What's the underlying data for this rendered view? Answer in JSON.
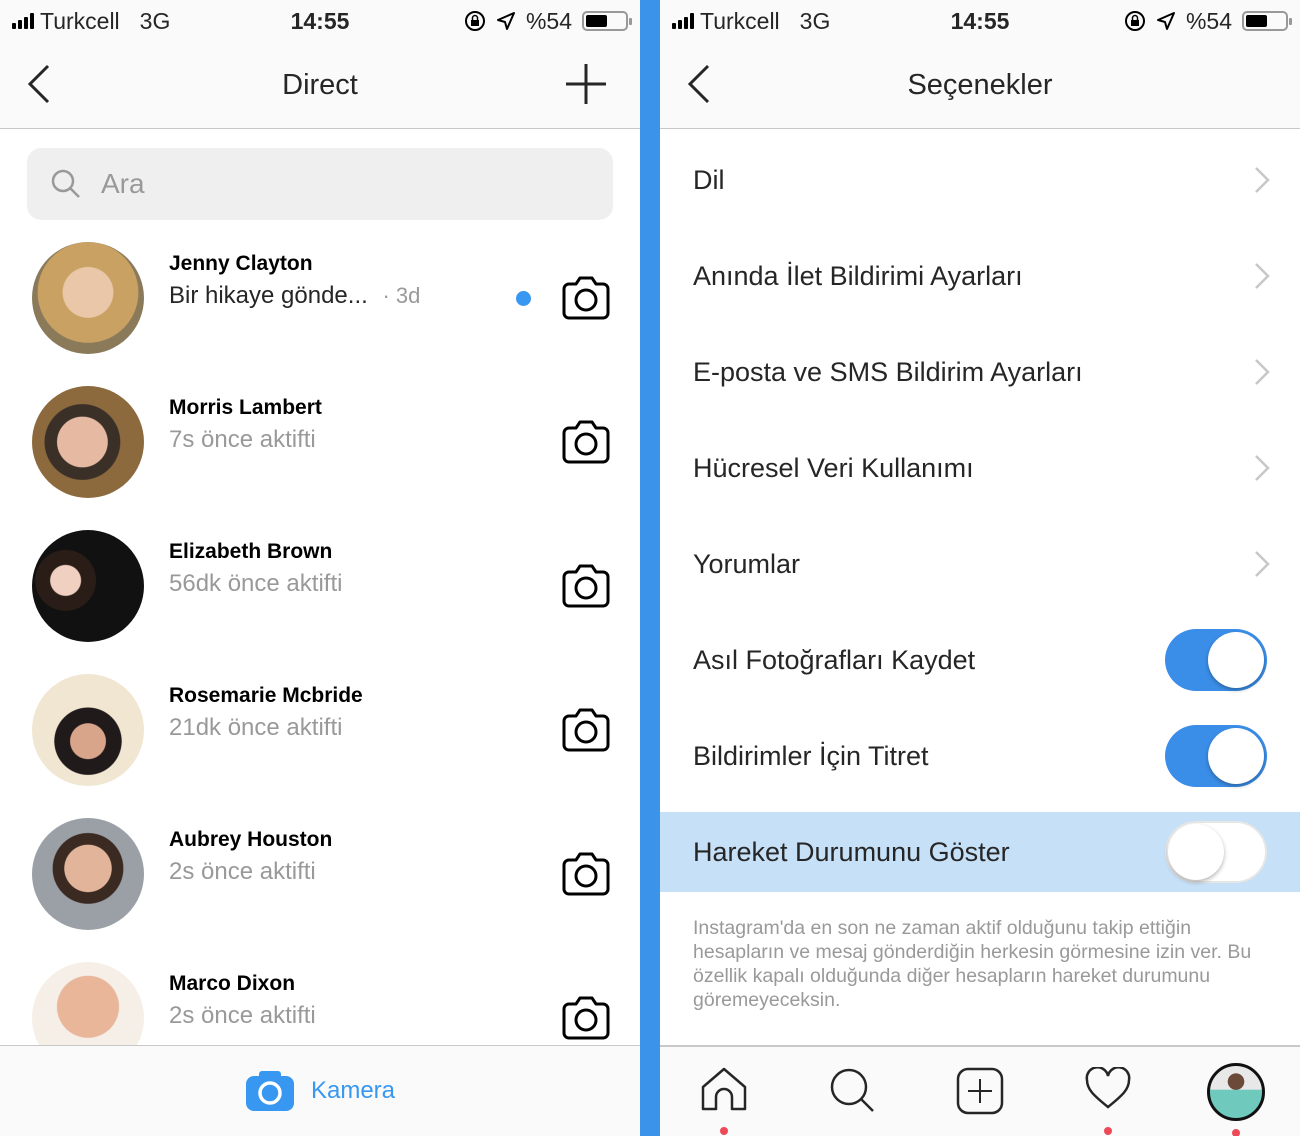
{
  "status_bar": {
    "carrier": "Turkcell",
    "network": "3G",
    "time": "14:55",
    "battery": "%54",
    "battery_level": 0.54
  },
  "colors": {
    "accent": "#3897f0",
    "divider": "#3b94ea",
    "highlight": "#c6e0f8",
    "notification_dot": "#ed4956"
  },
  "direct": {
    "title": "Direct",
    "search_placeholder": "Ara",
    "chats": [
      {
        "name": "Jenny Clayton",
        "subtitle": "Bir hikaye gönde...",
        "time": "· 3d",
        "unread": true
      },
      {
        "name": "Morris Lambert",
        "subtitle": "7s önce aktifti",
        "unread": false
      },
      {
        "name": "Elizabeth Brown",
        "subtitle": "56dk önce aktifti",
        "unread": false
      },
      {
        "name": "Rosemarie Mcbride",
        "subtitle": "21dk önce aktifti",
        "unread": false
      },
      {
        "name": "Aubrey Houston",
        "subtitle": "2s önce aktifti",
        "unread": false
      },
      {
        "name": "Marco Dixon",
        "subtitle": "2s önce aktifti",
        "unread": false
      }
    ],
    "camera_label": "Kamera"
  },
  "options": {
    "title": "Seçenekler",
    "items": [
      {
        "label": "Dil",
        "type": "link"
      },
      {
        "label": "Anında İlet Bildirimi Ayarları",
        "type": "link"
      },
      {
        "label": "E-posta ve SMS Bildirim Ayarları",
        "type": "link"
      },
      {
        "label": "Hücresel Veri Kullanımı",
        "type": "link"
      },
      {
        "label": "Yorumlar",
        "type": "link"
      },
      {
        "label": "Asıl Fotoğrafları Kaydet",
        "type": "toggle",
        "on": true
      },
      {
        "label": "Bildirimler İçin Titret",
        "type": "toggle",
        "on": true
      },
      {
        "label": "Hareket Durumunu Göster",
        "type": "toggle",
        "on": false,
        "highlighted": true
      }
    ],
    "description": "Instagram'da en son ne zaman aktif olduğunu takip ettiğin hesapların ve mesaj gönderdiğin herkesin görmesine izin ver. Bu özellik kapalı olduğunda diğer hesapların hareket durumunu göremeyeceksin."
  },
  "tabbar": {
    "tabs": [
      {
        "icon": "home-icon",
        "badge": true
      },
      {
        "icon": "search-icon",
        "badge": false
      },
      {
        "icon": "add-post-icon",
        "badge": false
      },
      {
        "icon": "heart-icon",
        "badge": true
      },
      {
        "icon": "profile-avatar",
        "badge": true
      }
    ]
  }
}
